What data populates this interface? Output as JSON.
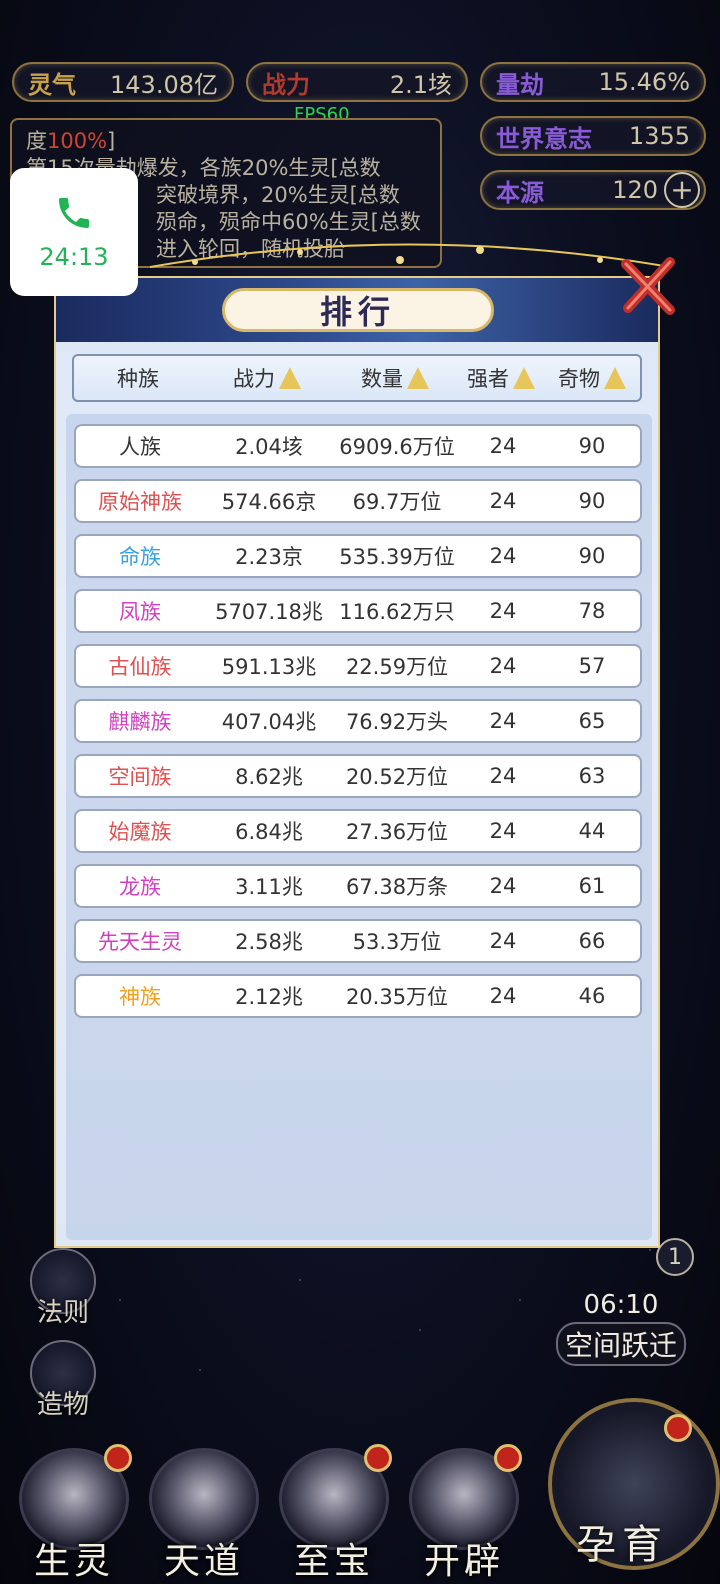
{
  "top_stats": {
    "lingqi": {
      "label": "灵气",
      "value": "143.08亿"
    },
    "zhanli": {
      "label": "战力",
      "value": "2.1垓"
    },
    "liangjie": {
      "label": "量劫",
      "value": "15.46%"
    },
    "shijie": {
      "label": "世界意志",
      "value": "1355"
    },
    "benyuan": {
      "label": "本源",
      "value": "120"
    }
  },
  "fps": "FPS60",
  "log": {
    "line1_prefix": "度",
    "line1_hl": "100%",
    "line1_suffix": "]",
    "line2": "第15次量劫爆发，各族20%生灵[总数",
    "line3": "突破境界，20%生灵[总数",
    "line4": "殒命，殒命中60%生灵[总数",
    "line5": "进入轮回，随机投胎"
  },
  "call": {
    "time": "24:13"
  },
  "dialog": {
    "title": "排行",
    "headers": [
      "种族",
      "战力",
      "数量",
      "强者",
      "奇物"
    ],
    "rows": [
      {
        "name": "人族",
        "color": "#333333",
        "power": "2.04垓",
        "count": "6909.6万位",
        "strong": "24",
        "items": "90"
      },
      {
        "name": "原始神族",
        "color": "#e05050",
        "power": "574.66京",
        "count": "69.7万位",
        "strong": "24",
        "items": "90"
      },
      {
        "name": "命族",
        "color": "#3aa0e0",
        "power": "2.23京",
        "count": "535.39万位",
        "strong": "24",
        "items": "90"
      },
      {
        "name": "凤族",
        "color": "#d040c0",
        "power": "5707.18兆",
        "count": "116.62万只",
        "strong": "24",
        "items": "78"
      },
      {
        "name": "古仙族",
        "color": "#e05050",
        "power": "591.13兆",
        "count": "22.59万位",
        "strong": "24",
        "items": "57"
      },
      {
        "name": "麒麟族",
        "color": "#d040c0",
        "power": "407.04兆",
        "count": "76.92万头",
        "strong": "24",
        "items": "65"
      },
      {
        "name": "空间族",
        "color": "#e05050",
        "power": "8.62兆",
        "count": "20.52万位",
        "strong": "24",
        "items": "63"
      },
      {
        "name": "始魔族",
        "color": "#e05050",
        "power": "6.84兆",
        "count": "27.36万位",
        "strong": "24",
        "items": "44"
      },
      {
        "name": "龙族",
        "color": "#d040c0",
        "power": "3.11兆",
        "count": "67.38万条",
        "strong": "24",
        "items": "61"
      },
      {
        "name": "先天生灵",
        "color": "#d040c0",
        "power": "2.58兆",
        "count": "53.3万位",
        "strong": "24",
        "items": "66"
      },
      {
        "name": "神族",
        "color": "#f0a020",
        "power": "2.12兆",
        "count": "20.35万位",
        "strong": "24",
        "items": "46"
      }
    ]
  },
  "side_buttons": {
    "faze": "法则",
    "zaowu": "造物"
  },
  "timer": {
    "time": "06:10",
    "label": "空间跃迁",
    "badge": "1"
  },
  "bottom_nav": [
    "生灵",
    "天道",
    "至宝",
    "开辟"
  ],
  "big_button": "孕育"
}
